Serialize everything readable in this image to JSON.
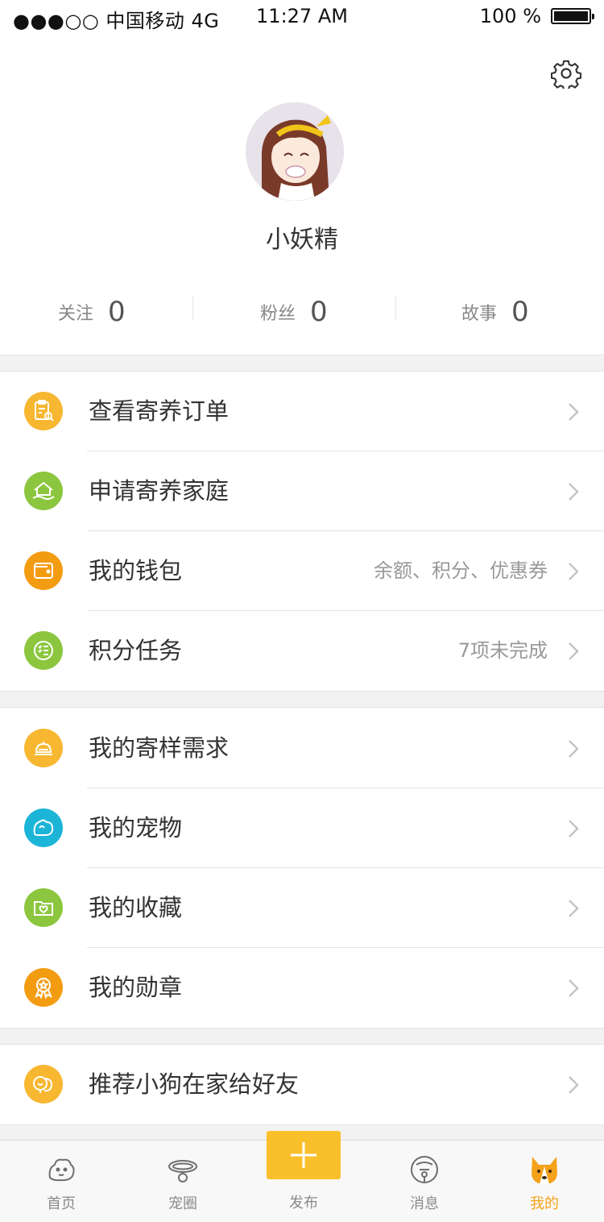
{
  "status_bar": {
    "carrier": "●●●○○ 中国移动 4G",
    "time": "11:27 AM",
    "battery": "100 %"
  },
  "profile": {
    "username": "小妖精",
    "stats": [
      {
        "label": "关注",
        "count": "0"
      },
      {
        "label": "粉丝",
        "count": "0"
      },
      {
        "label": "故事",
        "count": "0"
      }
    ]
  },
  "menu_groups": [
    [
      {
        "label": "查看寄养订单",
        "sub": "",
        "icon": "order-search-icon",
        "color": "#f7b731"
      },
      {
        "label": "申请寄养家庭",
        "sub": "",
        "icon": "house-hand-icon",
        "color": "#8cc63f"
      },
      {
        "label": "我的钱包",
        "sub": "余额、积分、优惠券",
        "icon": "wallet-icon",
        "color": "#f39c12"
      },
      {
        "label": "积分任务",
        "sub": "7项未完成",
        "icon": "checklist-icon",
        "color": "#8cc63f"
      }
    ],
    [
      {
        "label": "我的寄样需求",
        "sub": "",
        "icon": "service-bell-icon",
        "color": "#f7b731"
      },
      {
        "label": "我的宠物",
        "sub": "",
        "icon": "pet-icon",
        "color": "#1cb5d8"
      },
      {
        "label": "我的收藏",
        "sub": "",
        "icon": "favorites-folder-icon",
        "color": "#8cc63f"
      },
      {
        "label": "我的勋章",
        "sub": "",
        "icon": "medal-icon",
        "color": "#f39c12"
      }
    ],
    [
      {
        "label": "推荐小狗在家给好友",
        "sub": "",
        "icon": "recommend-icon",
        "color": "#f7b731"
      }
    ]
  ],
  "tabbar": {
    "tabs": [
      {
        "label": "首页",
        "icon": "home-pet-icon"
      },
      {
        "label": "宠圈",
        "icon": "collar-icon"
      },
      {
        "label": "发布",
        "icon": "plus-icon"
      },
      {
        "label": "消息",
        "icon": "bell-icon"
      },
      {
        "label": "我的",
        "icon": "corgi-icon"
      }
    ],
    "active": "我的",
    "accent": "#f5a21a",
    "publish_color": "#f9c02b"
  }
}
